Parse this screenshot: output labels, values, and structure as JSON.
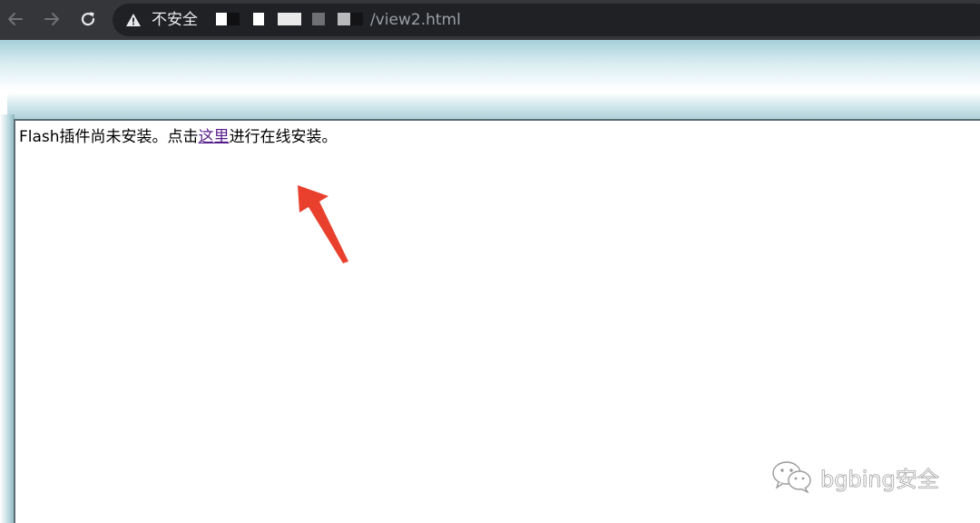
{
  "browser": {
    "back_icon": "arrow-left-icon",
    "forward_icon": "arrow-right-icon",
    "reload_icon": "reload-icon",
    "address_bar": {
      "security_icon": "warning-triangle-icon",
      "security_label": "不安全",
      "url_visible_suffix": "/view2.html"
    }
  },
  "page": {
    "notice": {
      "before_link": "Flash插件尚未安装。点击",
      "link_text": "这里",
      "after_link": "进行在线安装。"
    }
  },
  "annotation": {
    "arrow_color": "#e8402c"
  },
  "watermark": {
    "icon": "wechat-logo-icon",
    "text": "bgbing安全"
  }
}
